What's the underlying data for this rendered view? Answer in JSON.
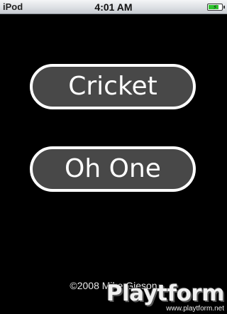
{
  "status_bar": {
    "carrier": "iPod",
    "time": "4:01 AM",
    "battery_level": 0.8
  },
  "menu": {
    "buttons": [
      {
        "label": "Cricket"
      },
      {
        "label": "Oh One"
      }
    ]
  },
  "footer": {
    "copyright": "©2008 Mike Gieson"
  },
  "watermark": {
    "logo": "Playtform",
    "url": "www.playtform.net"
  },
  "colors": {
    "background": "#000000",
    "button_fill": "#484848",
    "button_border": "#ffffff",
    "battery": "#2ec22e"
  }
}
